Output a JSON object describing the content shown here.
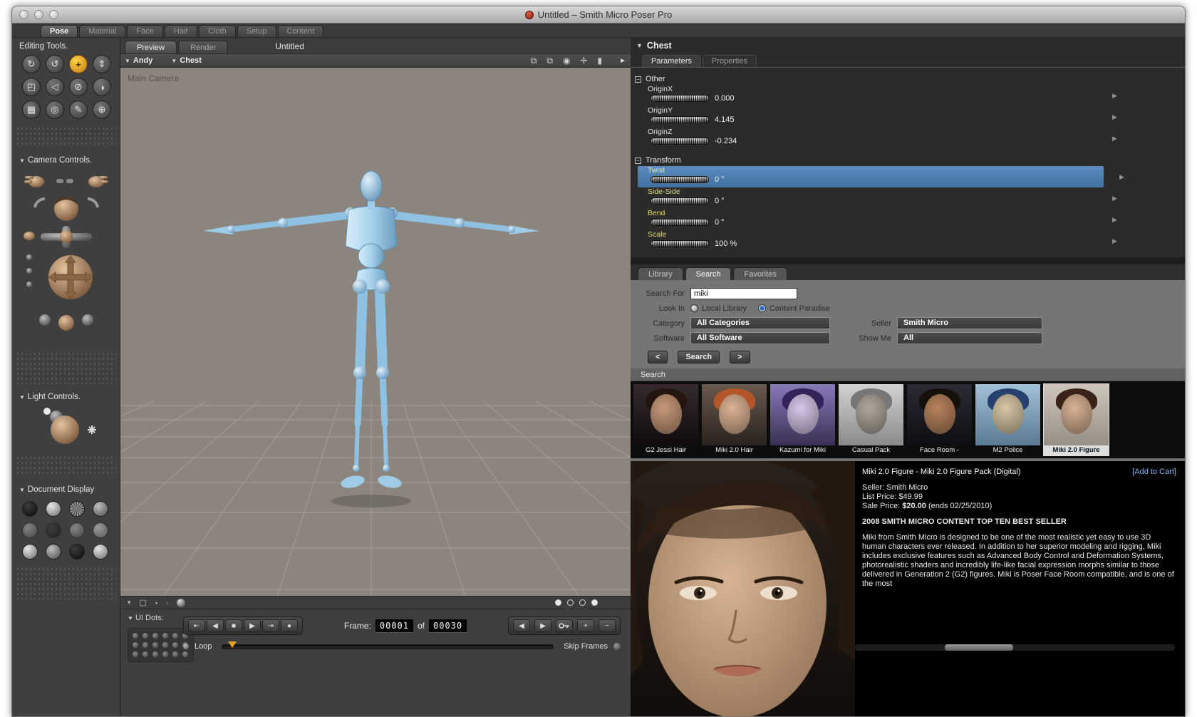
{
  "window": {
    "title": "Untitled – Smith Micro Poser Pro"
  },
  "mode_tabs": [
    "Pose",
    "Material",
    "Face",
    "Hair",
    "Cloth",
    "Setup",
    "Content"
  ],
  "sidebar": {
    "editing_tools_title": "Editing Tools.",
    "camera_controls_title": "Camera Controls.",
    "light_controls_title": "Light Controls.",
    "document_display_title": "Document Display"
  },
  "icons": {
    "rotate": "↻",
    "twist": "↺",
    "translate": "+",
    "translate_inout": "⇕",
    "scale": "◰",
    "taper": "◁",
    "chain_break": "⊘",
    "color": "◑",
    "grouping": "▦",
    "view_magnifier": "◎",
    "morphing": "✎",
    "direct_manip": "⊕",
    "transport": [
      "⇤",
      "◀",
      "■",
      "▶",
      "⇥",
      "●"
    ],
    "nav_prev": "◀",
    "nav_next": "▶",
    "add": "+",
    "remove": "−"
  },
  "viewport": {
    "doc_tab_preview": "Preview",
    "doc_tab_render": "Render",
    "doc_title": "Untitled",
    "actor": "Andy",
    "part": "Chest",
    "camera_label": "Main Camera"
  },
  "timeline": {
    "ui_dots_label": "UI Dots:",
    "frame_label": "Frame:",
    "frame_current": "00001",
    "of_label": "of",
    "frame_total": "00030",
    "loop_label": "Loop",
    "skip_frames_label": "Skip Frames"
  },
  "parameters": {
    "header": "Chest",
    "tab_parameters": "Parameters",
    "tab_properties": "Properties",
    "group_other": "Other",
    "group_transform": "Transform",
    "rows": [
      {
        "label": "OriginX",
        "value": "0.000"
      },
      {
        "label": "OriginY",
        "value": "4.145"
      },
      {
        "label": "OriginZ",
        "value": "-0.234"
      },
      {
        "label": "Twist",
        "value": "0 °"
      },
      {
        "label": "Side-Side",
        "value": "0 °"
      },
      {
        "label": "Bend",
        "value": "0 °"
      },
      {
        "label": "Scale",
        "value": "100 %"
      }
    ]
  },
  "library": {
    "tab_library": "Library",
    "tab_search": "Search",
    "tab_favorites": "Favorites",
    "form": {
      "search_for_label": "Search For",
      "search_value": "miki",
      "look_in_label": "Look In",
      "radio_local": "Local Library",
      "radio_paradise": "Content Paradise",
      "category_label": "Category",
      "category_value": "All Categories",
      "seller_label": "Seller",
      "seller_value": "Smith Micro",
      "software_label": "Software",
      "software_value": "All Software",
      "show_me_label": "Show Me",
      "show_me_value": "All",
      "prev_label": "<",
      "search_button": "Search",
      "next_label": ">"
    },
    "results_label": "Search",
    "thumbnails": [
      {
        "caption": "G2 Jessi Hair"
      },
      {
        "caption": "Miki 2.0 Hair"
      },
      {
        "caption": "Kazumi for Miki"
      },
      {
        "caption": "Casual Pack"
      },
      {
        "caption": "Face Room -"
      },
      {
        "caption": "M2 Police"
      },
      {
        "caption": "Miki 2.0 Figure"
      }
    ],
    "product": {
      "title": "Miki 2.0 Figure - Miki 2.0 Figure Pack (Digital)",
      "add_to_cart": "[Add to Cart]",
      "seller": "Seller: Smith Micro",
      "list_price": "List Price: $49.99",
      "sale_price_prefix": "Sale Price: ",
      "sale_price_bold": "$20.00",
      "sale_price_suffix": " (ends 02/25/2010)",
      "banner": "2008 SMITH MICRO CONTENT TOP TEN BEST SELLER",
      "description": "Miki from Smith Micro is designed to be one of the most realistic yet easy to use 3D human characters ever released. In addition to her superior modeling and rigging, Miki includes exclusive features such as Advanced Body Control and Deformation Systems, photorealistic shaders and incredibly life-like facial expression morphs similar to those delivered in Generation 2 (G2) figures. Miki is Poser Face Room compatible, and is one of the most"
    }
  }
}
